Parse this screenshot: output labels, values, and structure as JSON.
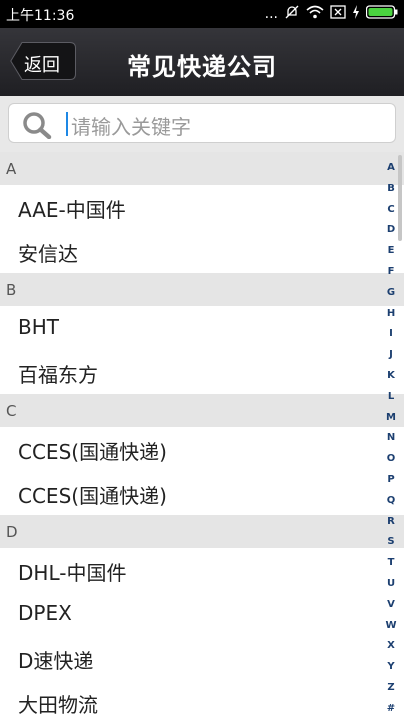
{
  "status_bar": {
    "time": "上午11:36",
    "more_indicator": "..."
  },
  "nav": {
    "back_label": "返回",
    "title": "常见快递公司"
  },
  "search": {
    "placeholder": "请输入关键字"
  },
  "sections": [
    {
      "letter": "A",
      "items": [
        "AAE-中国件",
        "安信达"
      ]
    },
    {
      "letter": "B",
      "items": [
        "BHT",
        "百福东方"
      ]
    },
    {
      "letter": "C",
      "items": [
        "CCES(国通快递)",
        "CCES(国通快递)"
      ]
    },
    {
      "letter": "D",
      "items": [
        "DHL-中国件",
        "DPEX",
        "D速快递",
        "大田物流"
      ]
    }
  ],
  "index_letters": [
    "A",
    "B",
    "C",
    "D",
    "E",
    "F",
    "G",
    "H",
    "I",
    "J",
    "K",
    "L",
    "M",
    "N",
    "O",
    "P",
    "Q",
    "R",
    "S",
    "T",
    "U",
    "V",
    "W",
    "X",
    "Y",
    "Z",
    "#"
  ],
  "colors": {
    "nav_bg": "#2a2a2e",
    "index_letter": "#1c3f70",
    "section_bg": "#e5e5e5",
    "search_bg": "#e8e8e8"
  },
  "icons": [
    "dots-icon",
    "mute-icon",
    "wifi-icon",
    "sim-icon",
    "charging-icon",
    "battery-icon",
    "search-icon"
  ]
}
